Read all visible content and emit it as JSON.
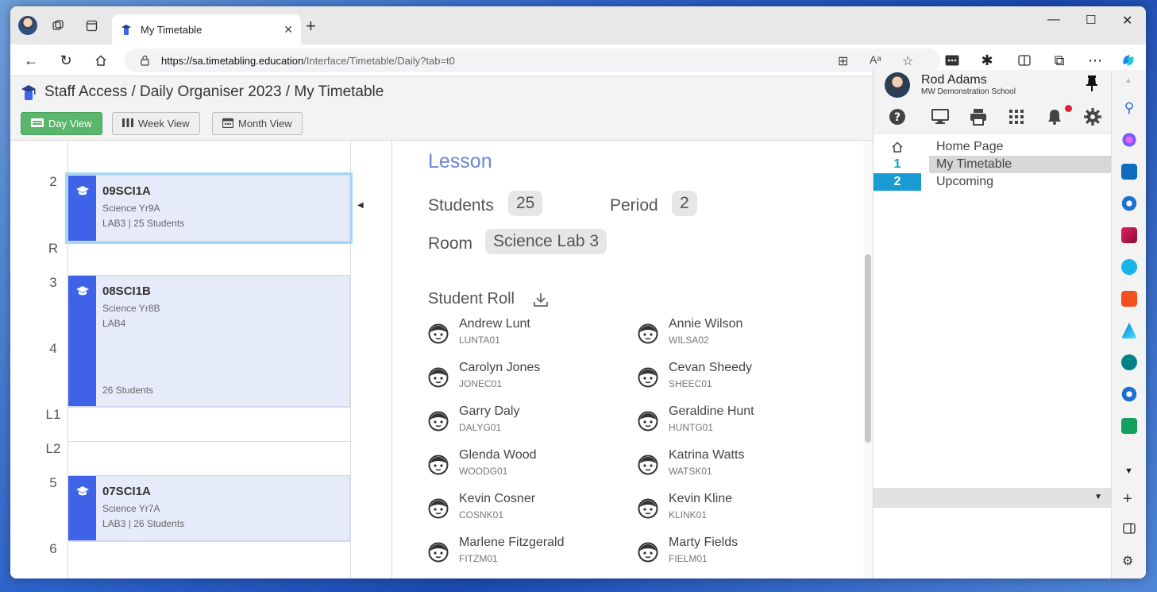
{
  "browser": {
    "tab_title": "My Timetable",
    "new_tab_label": "+",
    "url_host": "https://sa.timetabling.education",
    "url_path": "/Interface/Timetable/Daily?tab=t0"
  },
  "app": {
    "breadcrumb": "Staff Access / Daily Organiser 2023 / My Timetable",
    "views": [
      {
        "label": "Day View",
        "active": true
      },
      {
        "label": "Week View",
        "active": false
      },
      {
        "label": "Month View",
        "active": false
      }
    ]
  },
  "timetable": {
    "periods": [
      "2",
      "R",
      "3",
      "4",
      "L1",
      "L2",
      "5",
      "6"
    ],
    "lessons": [
      {
        "code": "09SCI1A",
        "subject": "Science Yr9A",
        "room": "LAB3 | 25 Students",
        "selected": true
      },
      {
        "code": "08SCI1B",
        "subject": "Science Yr8B",
        "room": "LAB4",
        "students": "26 Students"
      },
      {
        "code": "07SCI1A",
        "subject": "Science Yr7A",
        "room": "LAB3 | 26 Students"
      }
    ]
  },
  "detail": {
    "title": "Lesson",
    "students_label": "Students",
    "students_value": "25",
    "period_label": "Period",
    "period_value": "2",
    "room_label": "Room",
    "room_value": "Science Lab 3",
    "roll_title": "Student Roll",
    "students": [
      {
        "name": "Andrew Lunt",
        "id": "LUNTA01"
      },
      {
        "name": "Annie Wilson",
        "id": "WILSA02"
      },
      {
        "name": "Carolyn Jones",
        "id": "JONEC01"
      },
      {
        "name": "Cevan Sheedy",
        "id": "SHEEC01"
      },
      {
        "name": "Garry Daly",
        "id": "DALYG01"
      },
      {
        "name": "Geraldine Hunt",
        "id": "HUNTG01"
      },
      {
        "name": "Glenda Wood",
        "id": "WOODG01"
      },
      {
        "name": "Katrina Watts",
        "id": "WATSK01"
      },
      {
        "name": "Kevin Cosner",
        "id": "COSNK01"
      },
      {
        "name": "Kevin Kline",
        "id": "KLINK01"
      },
      {
        "name": "Marlene Fitzgerald",
        "id": "FITZM01"
      },
      {
        "name": "Marty Fields",
        "id": "FIELM01"
      }
    ]
  },
  "side_panel": {
    "user_name": "Rod Adams",
    "school": "MW Demonstration School",
    "nav": [
      {
        "num": "",
        "label": "Home Page"
      },
      {
        "num": "1",
        "label": "My Timetable"
      },
      {
        "num": "2",
        "label": "Upcoming"
      }
    ]
  },
  "colors": {
    "accent_blue": "#3e63e8",
    "active_green": "#59b66a",
    "badge_blue": "#1a9bd1"
  }
}
